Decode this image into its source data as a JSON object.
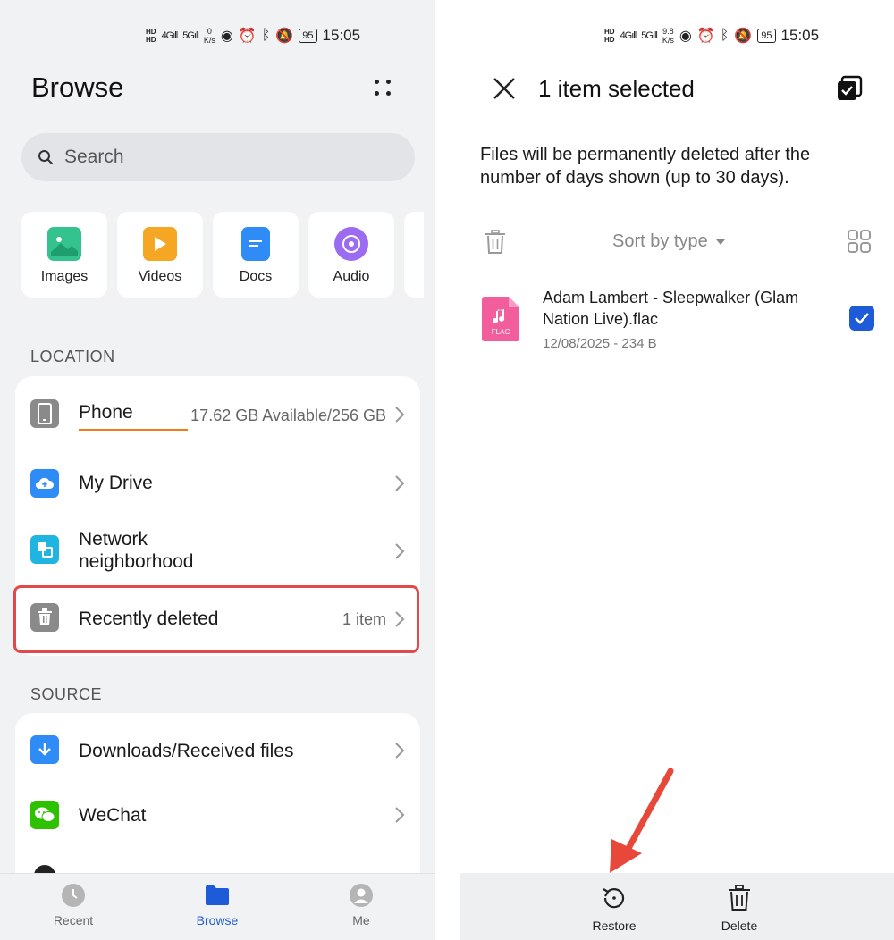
{
  "left": {
    "status": {
      "hd1": "HD",
      "hd2": "HD",
      "net1": "4G",
      "net2": "5G",
      "speed_value": "0",
      "speed_unit": "K/s",
      "battery": "95",
      "time": "15:05"
    },
    "title": "Browse",
    "search_placeholder": "Search",
    "categories": [
      {
        "label": "Images",
        "icon": "image-icon",
        "color": "#34c38f"
      },
      {
        "label": "Videos",
        "icon": "video-icon",
        "color": "#f5a623"
      },
      {
        "label": "Docs",
        "icon": "doc-icon",
        "color": "#2f8cf6"
      },
      {
        "label": "Audio",
        "icon": "audio-icon",
        "color": "#9b6bf2"
      }
    ],
    "location_label": "LOCATION",
    "location_items": [
      {
        "label": "Phone",
        "meta": "17.62 GB Available/256 GB",
        "icon": "phone-icon"
      },
      {
        "label": "My Drive",
        "meta": "",
        "icon": "cloud-drive-icon"
      },
      {
        "label": "Network\nneighborhood",
        "meta": "",
        "icon": "network-icon"
      },
      {
        "label": "Recently deleted",
        "meta": "1 item",
        "icon": "trash-icon"
      }
    ],
    "source_label": "SOURCE",
    "source_items": [
      {
        "label": "Downloads/Received files",
        "icon": "download-icon"
      },
      {
        "label": "WeChat",
        "icon": "wechat-icon"
      }
    ],
    "nav": [
      {
        "label": "Recent",
        "icon": "clock-icon",
        "active": false
      },
      {
        "label": "Browse",
        "icon": "folder-icon",
        "active": true
      },
      {
        "label": "Me",
        "icon": "user-icon",
        "active": false
      }
    ],
    "accent": "#1e5bd8",
    "highlight_color": "#e04a4a"
  },
  "right": {
    "status": {
      "hd1": "HD",
      "hd2": "HD",
      "net1": "4G",
      "net2": "5G",
      "speed_value": "9.8",
      "speed_unit": "K/s",
      "battery": "95",
      "time": "15:05"
    },
    "title": "1 item selected",
    "notice": "Files will be permanently deleted after the number of days shown (up to 30 days).",
    "sort_label": "Sort by type",
    "file": {
      "name": "Adam Lambert - Sleepwalker (Glam Nation Live).flac",
      "meta": "12/08/2025 - 234 B",
      "badge": "FLAC",
      "checked": true
    },
    "actions": [
      {
        "label": "Restore",
        "icon": "restore-icon"
      },
      {
        "label": "Delete",
        "icon": "trash-icon"
      }
    ]
  }
}
